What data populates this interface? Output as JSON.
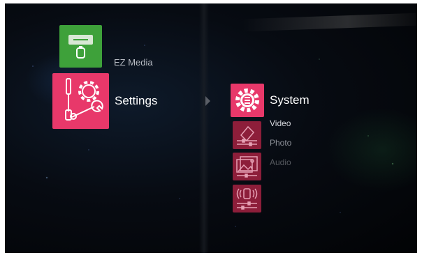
{
  "menu": {
    "ez_media": {
      "label": "EZ Media",
      "icon": "ez-media-icon",
      "color": "#3ea13a"
    },
    "settings": {
      "label": "Settings",
      "icon": "tools-gear-icon",
      "color": "#e8386a"
    }
  },
  "submenu": {
    "items": [
      {
        "label": "System",
        "icon": "system-gear-icon",
        "selected": true
      },
      {
        "label": "Video",
        "icon": "video-settings-icon"
      },
      {
        "label": "Photo",
        "icon": "photo-settings-icon"
      },
      {
        "label": "Audio",
        "icon": "audio-settings-icon"
      }
    ],
    "accent": "#e8386a",
    "inactive_tile_color": "#8d1e3a"
  }
}
